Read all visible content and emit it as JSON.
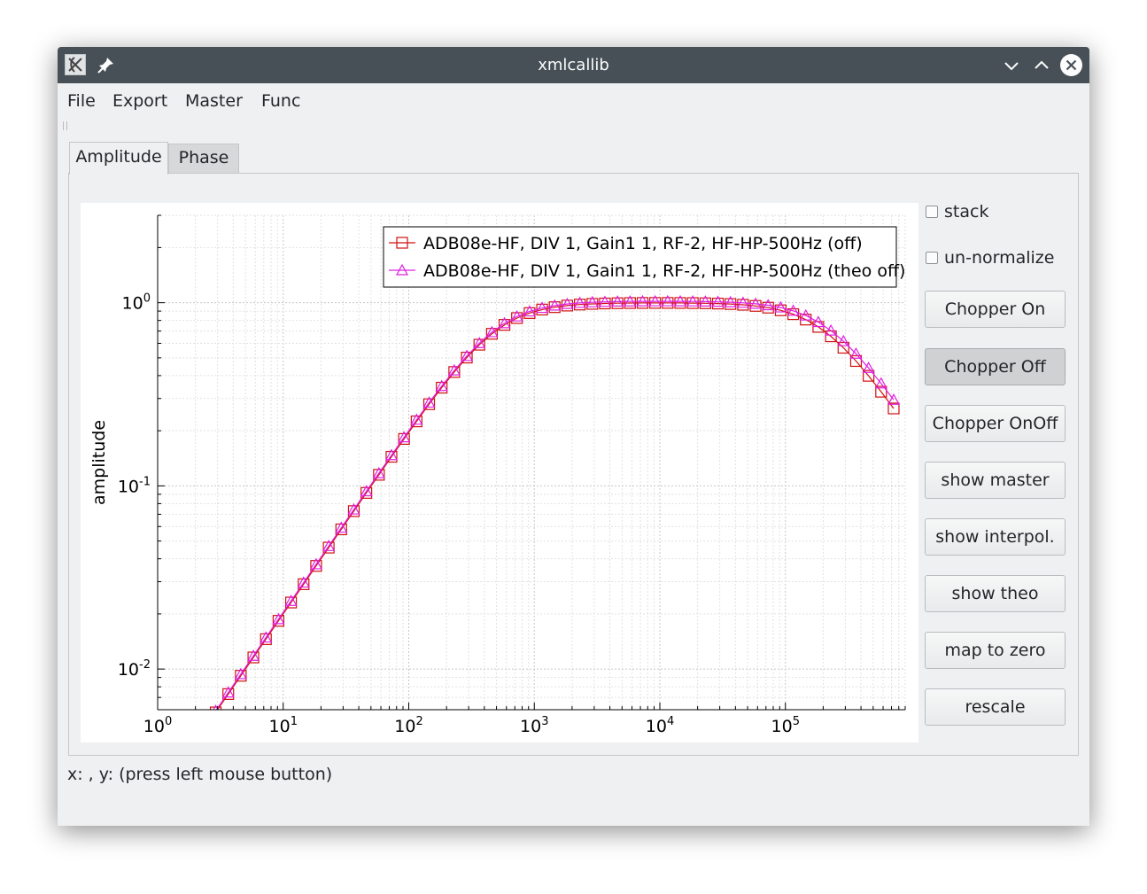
{
  "window": {
    "title": "xmlcallib"
  },
  "menu": [
    "File",
    "Export",
    "Master",
    "Func"
  ],
  "tabs": [
    {
      "label": "Amplitude",
      "active": true
    },
    {
      "label": "Phase",
      "active": false
    }
  ],
  "checkboxes": [
    {
      "label": "stack",
      "checked": false
    },
    {
      "label": "un-normalize",
      "checked": false
    }
  ],
  "buttons": [
    {
      "label": "Chopper On",
      "pressed": false
    },
    {
      "label": "Chopper Off",
      "pressed": true
    },
    {
      "label": "Chopper OnOff",
      "pressed": false
    },
    {
      "label": "show master",
      "pressed": false
    },
    {
      "label": "show interpol.",
      "pressed": false
    },
    {
      "label": "show theo",
      "pressed": false
    },
    {
      "label": "map to zero",
      "pressed": false
    },
    {
      "label": "rescale",
      "pressed": false
    }
  ],
  "status": "x: , y: (press left mouse button)",
  "colors": {
    "series_off": "#d01010",
    "series_theo": "#e020e0",
    "titlebar": "#475057"
  },
  "chart_data": {
    "type": "line",
    "xscale": "log",
    "yscale": "log",
    "xlim": [
      1,
      900000
    ],
    "ylim": [
      0.006,
      3
    ],
    "xlabel": "",
    "ylabel": "amplitude",
    "x_ticks": [
      {
        "base": "10",
        "exp": "0",
        "value": 1
      },
      {
        "base": "10",
        "exp": "1",
        "value": 10
      },
      {
        "base": "10",
        "exp": "2",
        "value": 100
      },
      {
        "base": "10",
        "exp": "3",
        "value": 1000
      },
      {
        "base": "10",
        "exp": "4",
        "value": 10000
      },
      {
        "base": "10",
        "exp": "5",
        "value": 100000
      }
    ],
    "y_ticks": [
      {
        "base": "10",
        "exp": "0",
        "value": 1
      },
      {
        "base": "10",
        "exp": "-1",
        "value": 0.1
      },
      {
        "base": "10",
        "exp": "-2",
        "value": 0.01
      }
    ],
    "grid": true,
    "legend_position": "top-right",
    "series": [
      {
        "name": "ADB08e-HF, DIV 1, Gain1 1, RF-2, HF-HP-500Hz (off)",
        "marker": "square",
        "color": "#d01010",
        "highpass_hz": 500,
        "lowpass_hz": 200000,
        "gain": 1,
        "x_start": 2.9,
        "x_end": 900000,
        "points_per_decade": 10
      },
      {
        "name": "ADB08e-HF, DIV 1, Gain1 1, RF-2, HF-HP-500Hz (theo off)",
        "marker": "triangle",
        "color": "#e020e0",
        "highpass_hz": 500,
        "lowpass_hz": 220000,
        "gain": 1.02,
        "x_start": 2.9,
        "x_end": 900000,
        "points_per_decade": 10
      }
    ]
  }
}
